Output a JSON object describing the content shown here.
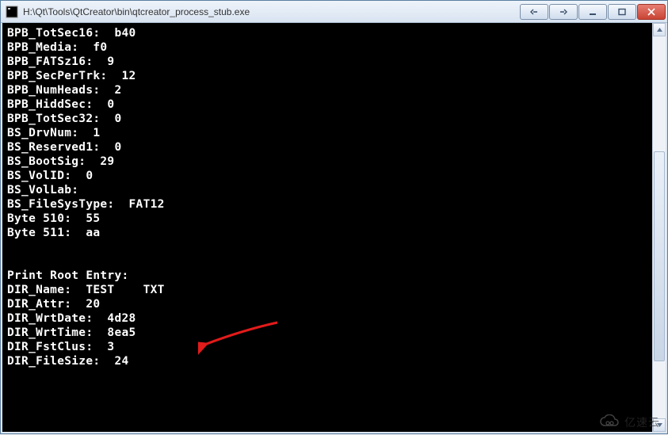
{
  "window": {
    "title": "H:\\Qt\\Tools\\QtCreator\\bin\\qtcreator_process_stub.exe"
  },
  "terminal": {
    "lines": [
      "BPB_TotSec16:  b40",
      "BPB_Media:  f0",
      "BPB_FATSz16:  9",
      "BPB_SecPerTrk:  12",
      "BPB_NumHeads:  2",
      "BPB_HiddSec:  0",
      "BPB_TotSec32:  0",
      "BS_DrvNum:  1",
      "BS_Reserved1:  0",
      "BS_BootSig:  29",
      "BS_VolID:  0",
      "BS_VolLab:",
      "BS_FileSysType:  FAT12",
      "Byte 510:  55",
      "Byte 511:  aa",
      "",
      "",
      "Print Root Entry:",
      "DIR_Name:  TEST    TXT",
      "DIR_Attr:  20",
      "DIR_WrtDate:  4d28",
      "DIR_WrtTime:  8ea5",
      "DIR_FstClus:  3",
      "DIR_FileSize:  24",
      ""
    ]
  },
  "annotation": {
    "arrow_color": "#e21b1b"
  },
  "watermark": {
    "text": "亿速云"
  }
}
